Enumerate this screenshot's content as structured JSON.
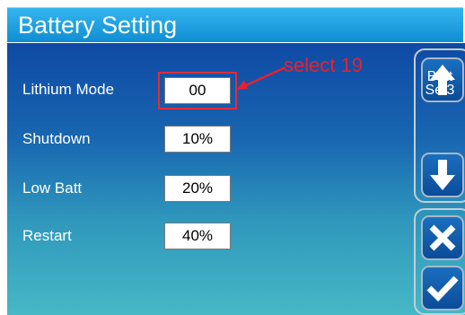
{
  "title": "Battery Setting",
  "rows": [
    {
      "label": "Lithium Mode",
      "value": "00"
    },
    {
      "label": "Shutdown",
      "value": "10%"
    },
    {
      "label": "Low Batt",
      "value": "20%"
    },
    {
      "label": "Restart",
      "value": "40%"
    }
  ],
  "annotation": "select 19",
  "side": {
    "page_label_line1": "Batt",
    "page_label_line2": "Set3",
    "up_icon": "arrow-up-icon",
    "down_icon": "arrow-down-icon",
    "cancel_icon": "x-icon",
    "confirm_icon": "check-icon"
  },
  "colors": {
    "title_bar": "#1a9ee0",
    "panel_top": "#0f4aa5",
    "panel_bottom": "#46b8c6",
    "annotation": "#e8202e"
  }
}
